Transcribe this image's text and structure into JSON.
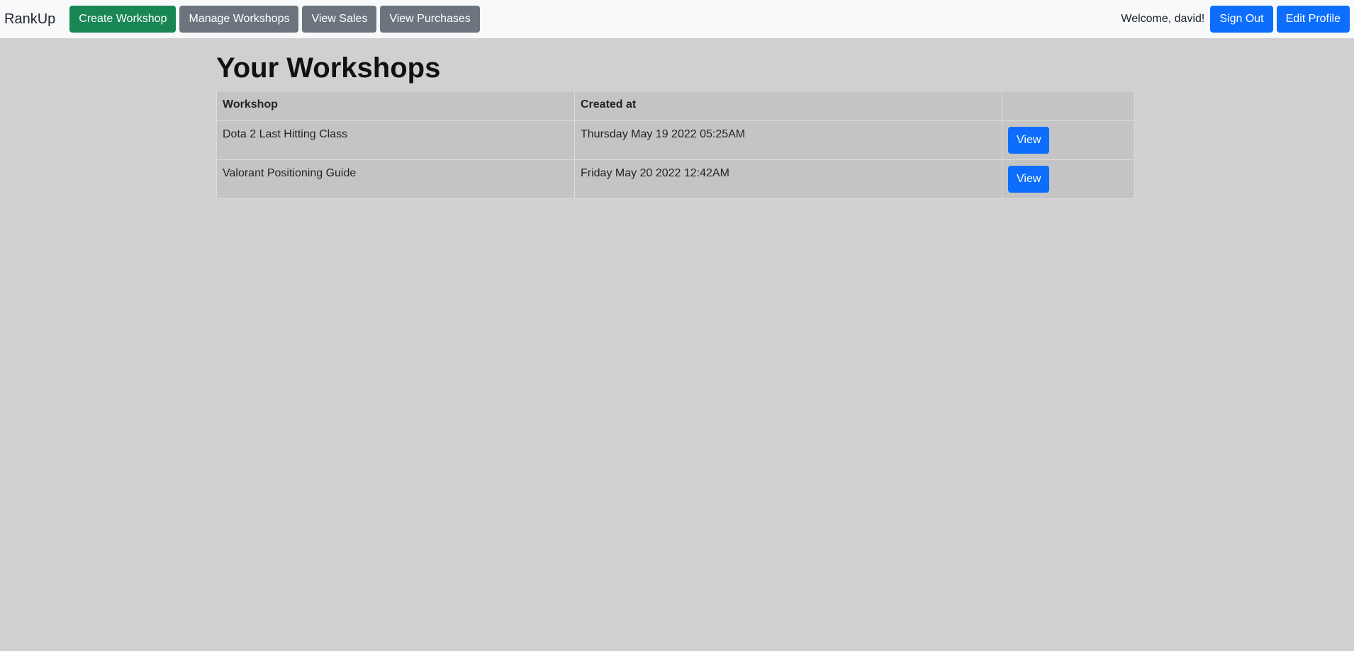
{
  "navbar": {
    "brand": "RankUp",
    "buttons": [
      {
        "label": "Create Workshop",
        "variant": "success"
      },
      {
        "label": "Manage Workshops",
        "variant": "secondary"
      },
      {
        "label": "View Sales",
        "variant": "secondary"
      },
      {
        "label": "View Purchases",
        "variant": "secondary"
      }
    ],
    "welcome": "Welcome, david!",
    "sign_out_label": "Sign Out",
    "edit_profile_label": "Edit Profile"
  },
  "main": {
    "title": "Your Workshops",
    "table": {
      "headers": [
        "Workshop",
        "Created at",
        ""
      ],
      "rows": [
        {
          "workshop": "Dota 2 Last Hitting Class",
          "created_at": "Thursday May 19 2022 05:25AM",
          "action_label": "View"
        },
        {
          "workshop": "Valorant Positioning Guide",
          "created_at": "Friday May 20 2022 12:42AM",
          "action_label": "View"
        }
      ]
    }
  },
  "colors": {
    "background": "#d0d0d0",
    "navbar": "#f8f9fa",
    "success": "#198754",
    "secondary": "#6c757d",
    "primary": "#0d6efd",
    "table_background": "#c4c4c4"
  }
}
